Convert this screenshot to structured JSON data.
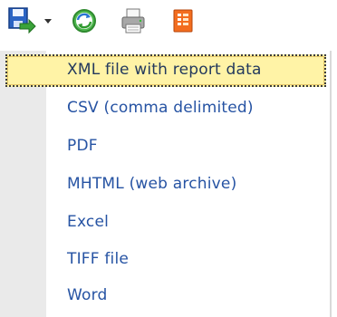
{
  "toolbar": {
    "icons": [
      "export-save-icon",
      "dropdown-arrow-icon",
      "refresh-icon",
      "print-icon",
      "report-icon"
    ]
  },
  "export_menu": {
    "items": [
      {
        "label": "XML file with report data",
        "selected": true
      },
      {
        "label": "CSV (comma delimited)"
      },
      {
        "label": "PDF"
      },
      {
        "label": "MHTML (web archive)"
      },
      {
        "label": "Excel"
      },
      {
        "label": "TIFF file"
      },
      {
        "label": "Word"
      }
    ]
  },
  "colors": {
    "menu_text": "#2653a3",
    "selected_bg": "#fff3a6",
    "gutter": "#eaeaea"
  }
}
